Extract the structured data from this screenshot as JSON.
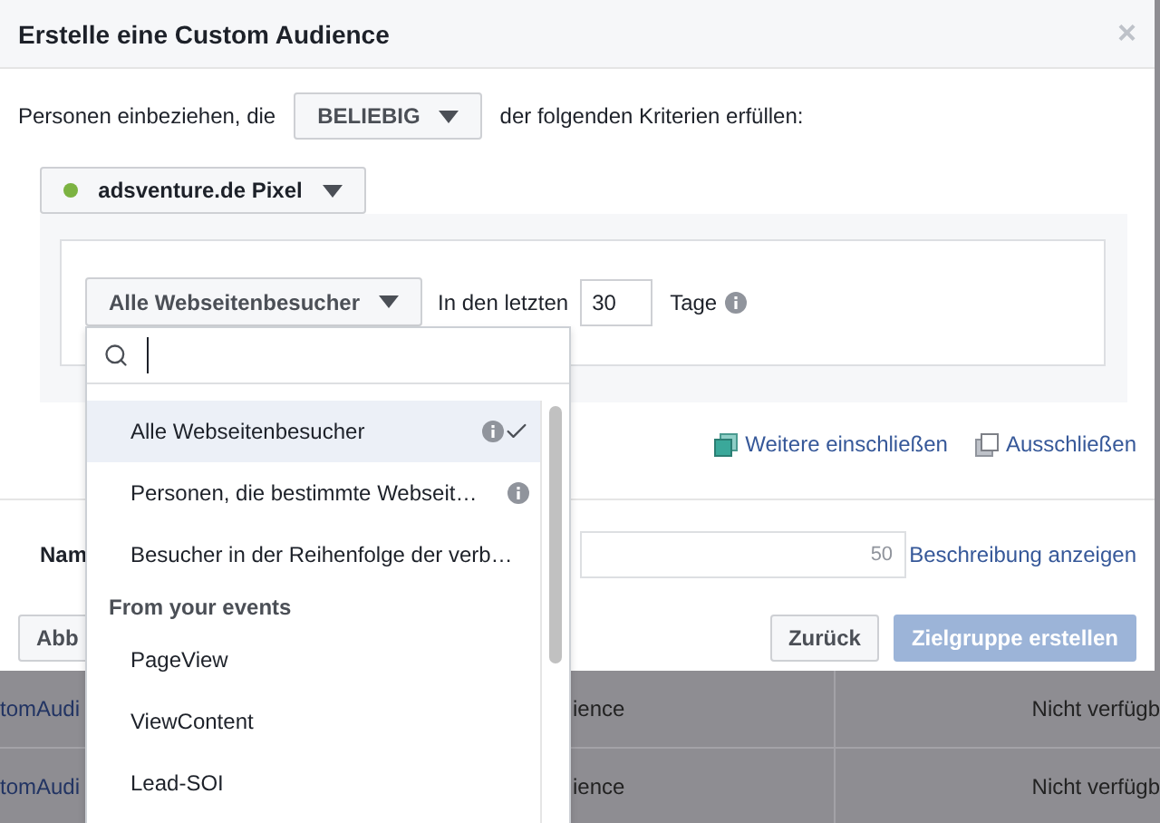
{
  "dialog": {
    "title": "Erstelle eine Custom Audience",
    "close": "×",
    "rule": {
      "prefix": "Personen einbeziehen, die",
      "mode": "BELIEBIG",
      "suffix": "der folgenden Kriterien erfüllen:"
    },
    "pixel": {
      "name": "adsventure.de Pixel",
      "active": true
    },
    "criterion": {
      "audience": "Alle Webseitenbesucher",
      "days_label": "In den letzten",
      "days": "30",
      "unit": "Tage"
    },
    "links": [
      {
        "label": "Weitere einschließen",
        "kind": "include"
      },
      {
        "label": "Ausschließen",
        "kind": "exclude"
      }
    ],
    "name": {
      "label": "Nam",
      "counter": "50",
      "link": "Beschreibung anzeigen"
    },
    "buttons": [
      {
        "label": "Abb",
        "kind": "secondary",
        "disabled": false
      },
      {
        "label": "Zurück",
        "kind": "secondary",
        "disabled": false
      },
      {
        "label": "Zielgruppe erstellen",
        "kind": "primary",
        "disabled": true
      }
    ]
  },
  "dropdown": {
    "items": [
      {
        "kind": "option",
        "label": "Alle Webseitenbesucher",
        "info": true,
        "selected": true
      },
      {
        "kind": "option",
        "label": "Personen, die bestimmte Webseit…",
        "info": true,
        "selected": false
      },
      {
        "kind": "option",
        "label": "Besucher in der Reihenfolge der verb…",
        "info": false,
        "selected": false
      },
      {
        "kind": "heading",
        "label": "From your events"
      },
      {
        "kind": "option",
        "label": "PageView",
        "info": false,
        "selected": false
      },
      {
        "kind": "option",
        "label": "ViewContent",
        "info": false,
        "selected": false
      },
      {
        "kind": "option",
        "label": "Lead-SOI",
        "info": false,
        "selected": false
      }
    ]
  },
  "background_table": {
    "rows": [
      {
        "cells": [
          "tomAudi",
          "ience",
          "Nicht verfügb"
        ]
      },
      {
        "cells": [
          "tomAudi",
          "ience",
          "Nicht verfügb"
        ]
      }
    ]
  }
}
